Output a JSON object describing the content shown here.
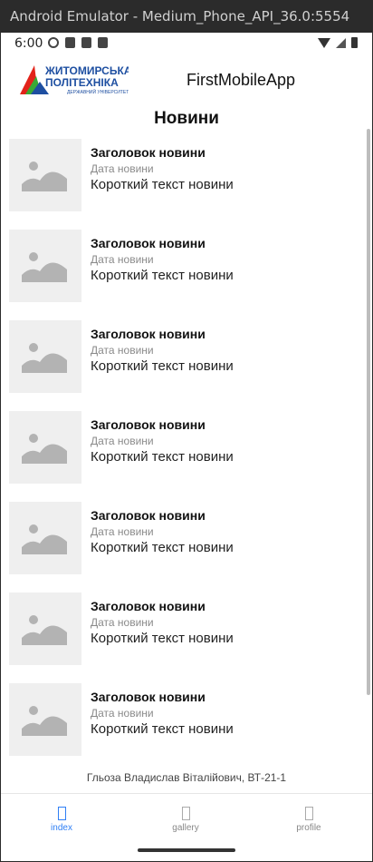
{
  "window": {
    "title": "Android Emulator - Medium_Phone_API_36.0:5554"
  },
  "status_bar": {
    "time": "6:00"
  },
  "app_bar": {
    "title": "FirstMobileApp",
    "logo_text": "ЖИТОМИРСЬКА ПОЛІТЕХНІКА ДЕРЖАВНИЙ УНІВЕРСИТЕТ"
  },
  "page": {
    "title": "Новини"
  },
  "news": [
    {
      "title": "Заголовок новини",
      "date": "Дата новини",
      "text": "Короткий текст новини"
    },
    {
      "title": "Заголовок новини",
      "date": "Дата новини",
      "text": "Короткий текст новини"
    },
    {
      "title": "Заголовок новини",
      "date": "Дата новини",
      "text": "Короткий текст новини"
    },
    {
      "title": "Заголовок новини",
      "date": "Дата новини",
      "text": "Короткий текст новини"
    },
    {
      "title": "Заголовок новини",
      "date": "Дата новини",
      "text": "Короткий текст новини"
    },
    {
      "title": "Заголовок новини",
      "date": "Дата новини",
      "text": "Короткий текст новини"
    },
    {
      "title": "Заголовок новини",
      "date": "Дата новини",
      "text": "Короткий текст новини"
    }
  ],
  "footer": {
    "author": "Гльоза Владислав Віталійович, ВТ-21-1"
  },
  "tabs": [
    {
      "label": "index",
      "active": true
    },
    {
      "label": "gallery",
      "active": false
    },
    {
      "label": "profile",
      "active": false
    }
  ],
  "colors": {
    "accent": "#2f7ff5",
    "logo_red": "#e2231a",
    "logo_blue": "#1e4fa1",
    "logo_green": "#3aa935"
  }
}
